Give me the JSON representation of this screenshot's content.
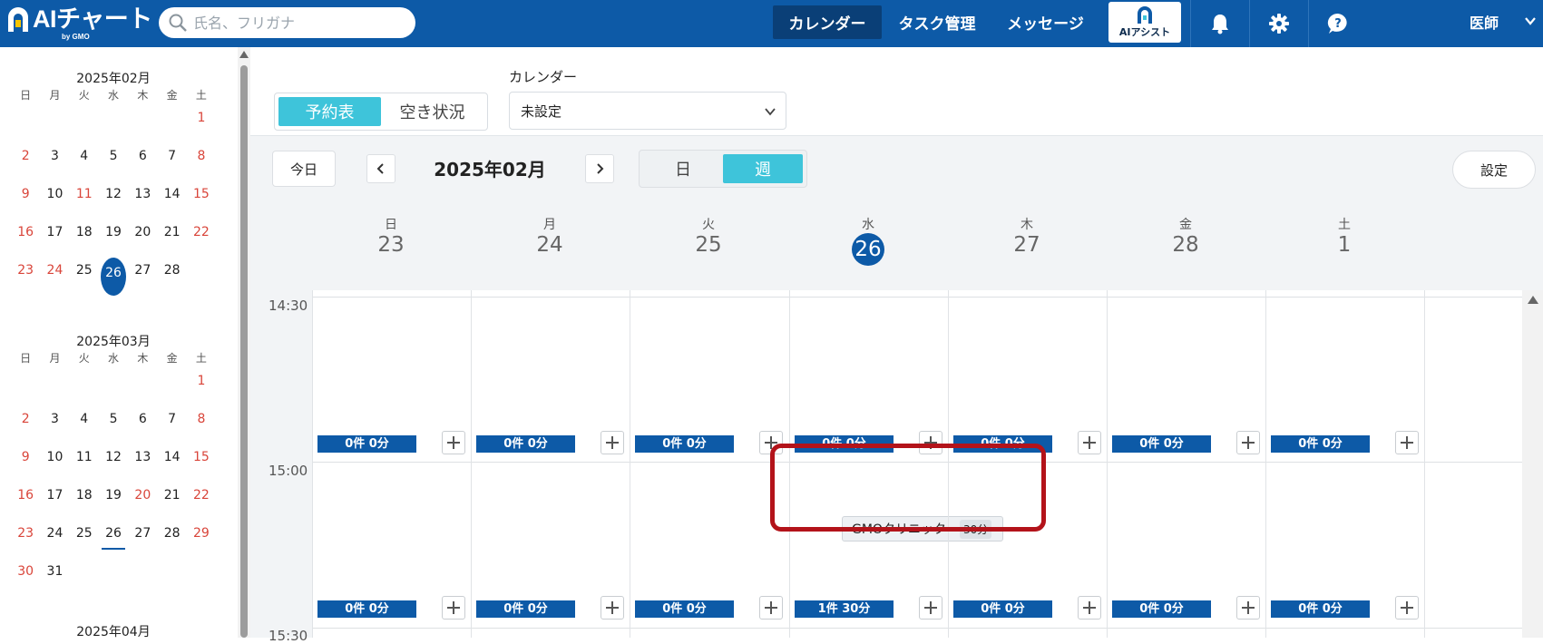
{
  "header": {
    "logo_text": "AIチャート",
    "logo_sub": "by GMO",
    "search_placeholder": "氏名、フリガナ",
    "nav": {
      "calendar": "カレンダー",
      "task": "タスク管理",
      "message": "メッセージ"
    },
    "ai_assist_label": "AIアシスト",
    "user_name": "医師",
    "icons": [
      "search-icon",
      "bell-icon",
      "gear-icon",
      "help-icon",
      "chevron-down-icon"
    ]
  },
  "sidebar": {
    "weekdays": [
      "日",
      "月",
      "火",
      "水",
      "木",
      "金",
      "土"
    ],
    "months": [
      {
        "title": "2025年02月",
        "weeks": [
          [
            "",
            "",
            "",
            "",
            "",
            "",
            "1"
          ],
          [
            "2",
            "3",
            "4",
            "5",
            "6",
            "7",
            "8"
          ],
          [
            "9",
            "10",
            "11",
            "12",
            "13",
            "14",
            "15"
          ],
          [
            "16",
            "17",
            "18",
            "19",
            "20",
            "21",
            "22"
          ],
          [
            "23",
            "24",
            "25",
            "26",
            "27",
            "28",
            ""
          ]
        ],
        "holidays": [
          "11",
          "24"
        ],
        "today": "26"
      },
      {
        "title": "2025年03月",
        "weeks": [
          [
            "",
            "",
            "",
            "",
            "",
            "",
            "1"
          ],
          [
            "2",
            "3",
            "4",
            "5",
            "6",
            "7",
            "8"
          ],
          [
            "9",
            "10",
            "11",
            "12",
            "13",
            "14",
            "15"
          ],
          [
            "16",
            "17",
            "18",
            "19",
            "20",
            "21",
            "22"
          ],
          [
            "23",
            "24",
            "25",
            "26",
            "27",
            "28",
            "29"
          ],
          [
            "30",
            "31",
            "",
            "",
            "",
            "",
            ""
          ]
        ],
        "holidays": [
          "20"
        ],
        "underline": "26"
      },
      {
        "title": "2025年04月",
        "weeks": [],
        "holidays": []
      }
    ]
  },
  "toolbar": {
    "view_schedule": "予約表",
    "view_availability": "空き状況",
    "calendar_label": "カレンダー",
    "calendar_value": "未設定",
    "today": "今日",
    "month": "2025年02月",
    "day": "日",
    "week": "週",
    "settings": "設定"
  },
  "week": {
    "days": [
      {
        "dow": "日",
        "num": "23"
      },
      {
        "dow": "月",
        "num": "24"
      },
      {
        "dow": "火",
        "num": "25"
      },
      {
        "dow": "水",
        "num": "26",
        "today": true
      },
      {
        "dow": "木",
        "num": "27"
      },
      {
        "dow": "金",
        "num": "28"
      },
      {
        "dow": "土",
        "num": "1"
      }
    ],
    "times": [
      "14:30",
      "15:00",
      "15:30"
    ],
    "slot1_counts": [
      "0件 0分",
      "0件 0分",
      "0件 0分",
      "0件 0分",
      "0件 0分",
      "0件 0分",
      "0件 0分"
    ],
    "slot2_counts": [
      "0件 0分",
      "0件 0分",
      "0件 0分",
      "1件 30分",
      "0件 0分",
      "0件 0分",
      "0件 0分"
    ],
    "event": {
      "title": "GMOクリニック",
      "duration": "30分"
    }
  },
  "colors": {
    "brand": "#0d5aa7",
    "accent": "#3ec4da",
    "holiday": "#d9453a",
    "highlight": "#b3131a"
  }
}
